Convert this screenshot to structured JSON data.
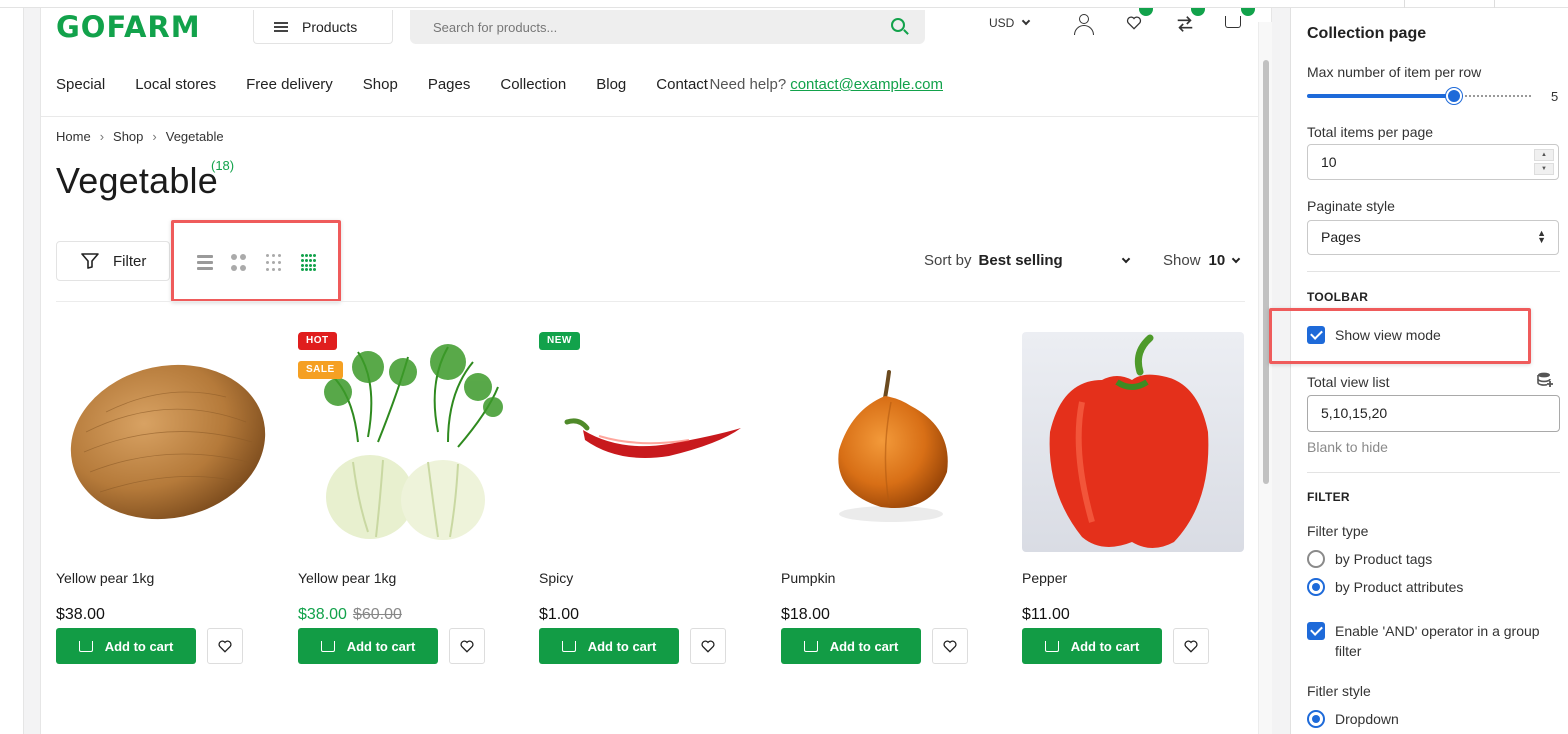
{
  "store": {
    "logo": "GOFARM",
    "products_label": "Products",
    "search_placeholder": "Search for products...",
    "currency": "USD"
  },
  "nav": {
    "items": [
      "Special",
      "Local stores",
      "Free delivery",
      "Shop",
      "Pages",
      "Collection",
      "Blog",
      "Contact"
    ],
    "help_text": "Need help?",
    "help_email": "contact@example.com"
  },
  "breadcrumb": [
    "Home",
    "Shop",
    "Vegetable"
  ],
  "collection": {
    "title": "Vegetable",
    "count": "(18)"
  },
  "toolbar": {
    "filter_label": "Filter",
    "view_modes": [
      "list-view-icon",
      "grid-2-icon",
      "grid-3-icon",
      "grid-4-icon"
    ],
    "active_view_mode": "grid-4-icon",
    "sort_label": "Sort by",
    "sort_value": "Best selling",
    "show_label": "Show",
    "show_value": "10"
  },
  "products": [
    {
      "name": "Yellow pear 1kg",
      "price": "$38.00",
      "old_price": "",
      "tags": [],
      "add_label": "Add to cart"
    },
    {
      "name": "Yellow pear 1kg",
      "price": "$38.00",
      "old_price": "$60.00",
      "tags": [
        "HOT",
        "SALE"
      ],
      "add_label": "Add to cart"
    },
    {
      "name": "Spicy",
      "price": "$1.00",
      "old_price": "",
      "tags": [
        "NEW"
      ],
      "add_label": "Add to cart"
    },
    {
      "name": "Pumpkin",
      "price": "$18.00",
      "old_price": "",
      "tags": [],
      "add_label": "Add to cart"
    },
    {
      "name": "Pepper",
      "price": "$11.00",
      "old_price": "",
      "tags": [],
      "add_label": "Add to cart"
    }
  ],
  "settings": {
    "heading": "Collection page",
    "max_per_row_label": "Max number of item per row",
    "max_per_row_value": "5",
    "max_per_row_fraction": 0.6,
    "items_per_page_label": "Total items per page",
    "items_per_page_value": "10",
    "paginate_label": "Paginate style",
    "paginate_value": "Pages",
    "toolbar_section": "TOOLBAR",
    "show_view_mode_label": "Show view mode",
    "show_view_mode_checked": true,
    "view_list_label": "Total view list",
    "view_list_value": "5,10,15,20",
    "view_list_hint": "Blank to hide",
    "filter_section": "FILTER",
    "filter_type_label": "Filter type",
    "filter_type_options": [
      "by Product tags",
      "by Product attributes"
    ],
    "filter_type_selected": "by Product attributes",
    "and_operator_label": "Enable 'AND' operator in a group filter",
    "and_operator_checked": true,
    "filter_style_label": "Fitler style",
    "filter_style_options": [
      "Dropdown"
    ],
    "filter_style_selected": "Dropdown"
  },
  "colors": {
    "brand_green": "#12a24b",
    "accent_blue": "#1e6ad9",
    "highlight_red": "#ef5b5b",
    "tag_hot": "#e01e1e",
    "tag_sale": "#f5a023",
    "tag_new": "#12a24b"
  }
}
